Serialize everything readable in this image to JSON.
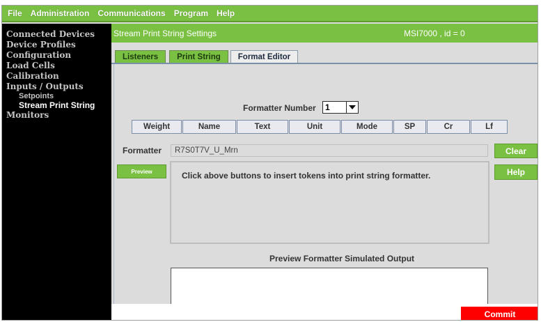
{
  "menu": [
    "File",
    "Administration",
    "Communications",
    "Program",
    "Help"
  ],
  "sidebar": {
    "items": [
      {
        "label": "Connected Devices"
      },
      {
        "label": "Device Profiles"
      },
      {
        "label": "Configuration"
      },
      {
        "label": "Load Cells"
      },
      {
        "label": "Calibration"
      },
      {
        "label": "Inputs / Outputs"
      },
      {
        "label": "Setpoints"
      },
      {
        "label": "Stream Print String"
      },
      {
        "label": "Monitors"
      }
    ]
  },
  "header": {
    "title": "Stream Print String Settings",
    "device": "MSI7000 , id = 0"
  },
  "tabs": [
    {
      "label": "Listeners"
    },
    {
      "label": "Print String"
    },
    {
      "label": "Format Editor"
    }
  ],
  "formatter_number": {
    "label": "Formatter Number",
    "value": "1"
  },
  "token_buttons": [
    "Weight",
    "Name",
    "Text",
    "Unit",
    "Mode",
    "SP",
    "Cr",
    "Lf"
  ],
  "formatter": {
    "label": "Formatter",
    "value": "R7S0T7V_U_Mrn"
  },
  "buttons": {
    "clear": "Clear",
    "preview": "Preview",
    "help": "Help",
    "commit": "Commit"
  },
  "message": "Click above buttons to insert tokens into print string formatter.",
  "preview_output_label": "Preview Formatter Simulated Output",
  "colors": {
    "accent_green": "#7ac143",
    "commit_red": "#ff0000",
    "sidebar_bg": "#000000"
  }
}
